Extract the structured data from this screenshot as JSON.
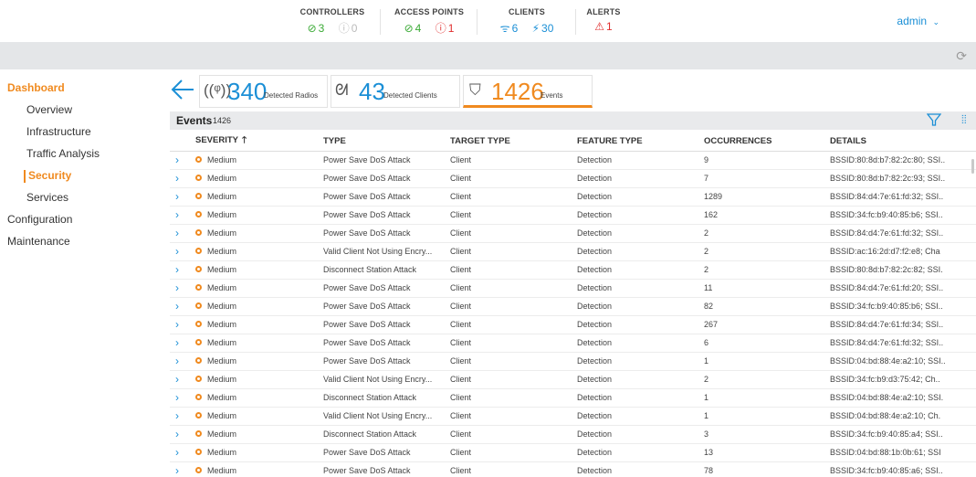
{
  "topbar": {
    "controllers": {
      "title": "CONTROLLERS",
      "ok": "3",
      "muted": "0"
    },
    "access_points": {
      "title": "ACCESS POINTS",
      "ok": "4",
      "err": "1"
    },
    "clients": {
      "title": "CLIENTS",
      "wireless": "6",
      "wired": "30"
    },
    "alerts": {
      "title": "ALERTS",
      "count": "1"
    },
    "user": "admin"
  },
  "sidebar": {
    "dashboard": "Dashboard",
    "overview": "Overview",
    "infrastructure": "Infrastructure",
    "traffic": "Traffic Analysis",
    "security": "Security",
    "services": "Services",
    "configuration": "Configuration",
    "maintenance": "Maintenance"
  },
  "cards": {
    "radios": {
      "value": "340",
      "label": "Detected Radios"
    },
    "clients": {
      "value": "43",
      "label": "Detected Clients"
    },
    "events": {
      "value": "1426",
      "label": "Events"
    }
  },
  "events": {
    "title": "Events",
    "count": "1426",
    "columns": [
      "SEVERITY",
      "TYPE",
      "TARGET TYPE",
      "FEATURE TYPE",
      "OCCURRENCES",
      "DETAILS"
    ],
    "rows": [
      [
        "Medium",
        "Power Save DoS Attack",
        "Client",
        "Detection",
        "9",
        "BSSID:80:8d:b7:82:2c:80; SSI.."
      ],
      [
        "Medium",
        "Power Save DoS Attack",
        "Client",
        "Detection",
        "7",
        "BSSID:80:8d:b7:82:2c:93; SSI.."
      ],
      [
        "Medium",
        "Power Save DoS Attack",
        "Client",
        "Detection",
        "1289",
        "BSSID:84:d4:7e:61:fd:32; SSI.."
      ],
      [
        "Medium",
        "Power Save DoS Attack",
        "Client",
        "Detection",
        "162",
        "BSSID:34:fc:b9:40:85:b6; SSI.."
      ],
      [
        "Medium",
        "Power Save DoS Attack",
        "Client",
        "Detection",
        "2",
        "BSSID:84:d4:7e:61:fd:32; SSI.."
      ],
      [
        "Medium",
        "Valid Client Not Using Encry...",
        "Client",
        "Detection",
        "2",
        "BSSID:ac:16:2d:d7:f2:e8; Cha"
      ],
      [
        "Medium",
        "Disconnect Station Attack",
        "Client",
        "Detection",
        "2",
        "BSSID:80:8d:b7:82:2c:82; SSI."
      ],
      [
        "Medium",
        "Power Save DoS Attack",
        "Client",
        "Detection",
        "11",
        "BSSID:84:d4:7e:61:fd:20; SSI.."
      ],
      [
        "Medium",
        "Power Save DoS Attack",
        "Client",
        "Detection",
        "82",
        "BSSID:34:fc:b9:40:85:b6; SSI.."
      ],
      [
        "Medium",
        "Power Save DoS Attack",
        "Client",
        "Detection",
        "267",
        "BSSID:84:d4:7e:61:fd:34; SSI.."
      ],
      [
        "Medium",
        "Power Save DoS Attack",
        "Client",
        "Detection",
        "6",
        "BSSID:84:d4:7e:61:fd:32; SSI.."
      ],
      [
        "Medium",
        "Power Save DoS Attack",
        "Client",
        "Detection",
        "1",
        "BSSID:04:bd:88:4e:a2:10; SSI.."
      ],
      [
        "Medium",
        "Valid Client Not Using Encry...",
        "Client",
        "Detection",
        "2",
        "BSSID:34:fc:b9:d3:75:42; Ch.."
      ],
      [
        "Medium",
        "Disconnect Station Attack",
        "Client",
        "Detection",
        "1",
        "BSSID:04:bd:88:4e:a2:10; SSI."
      ],
      [
        "Medium",
        "Valid Client Not Using Encry...",
        "Client",
        "Detection",
        "1",
        "BSSID:04:bd:88:4e:a2:10; Ch."
      ],
      [
        "Medium",
        "Disconnect Station Attack",
        "Client",
        "Detection",
        "3",
        "BSSID:34:fc:b9:40:85:a4; SSI.."
      ],
      [
        "Medium",
        "Power Save DoS Attack",
        "Client",
        "Detection",
        "13",
        "BSSID:04:bd:88:1b:0b:61; SSI"
      ],
      [
        "Medium",
        "Power Save DoS Attack",
        "Client",
        "Detection",
        "78",
        "BSSID:34:fc:b9:40:85:a6; SSI.."
      ]
    ]
  },
  "colors": {
    "accent": "#f08a1f",
    "link": "#1b8fd6",
    "ok": "#3aaa35",
    "error": "#e02d2d"
  },
  "icons": [
    "check-circle-icon",
    "info-circle-icon",
    "error-circle-icon",
    "wifi-icon",
    "wired-client-icon",
    "warning-triangle-icon",
    "chevron-down-icon",
    "refresh-icon",
    "back-arrow-icon",
    "radio-icon",
    "clients-icon",
    "shield-icon",
    "filter-icon",
    "columns-icon",
    "sort-up-icon",
    "expand-chevron-icon"
  ]
}
